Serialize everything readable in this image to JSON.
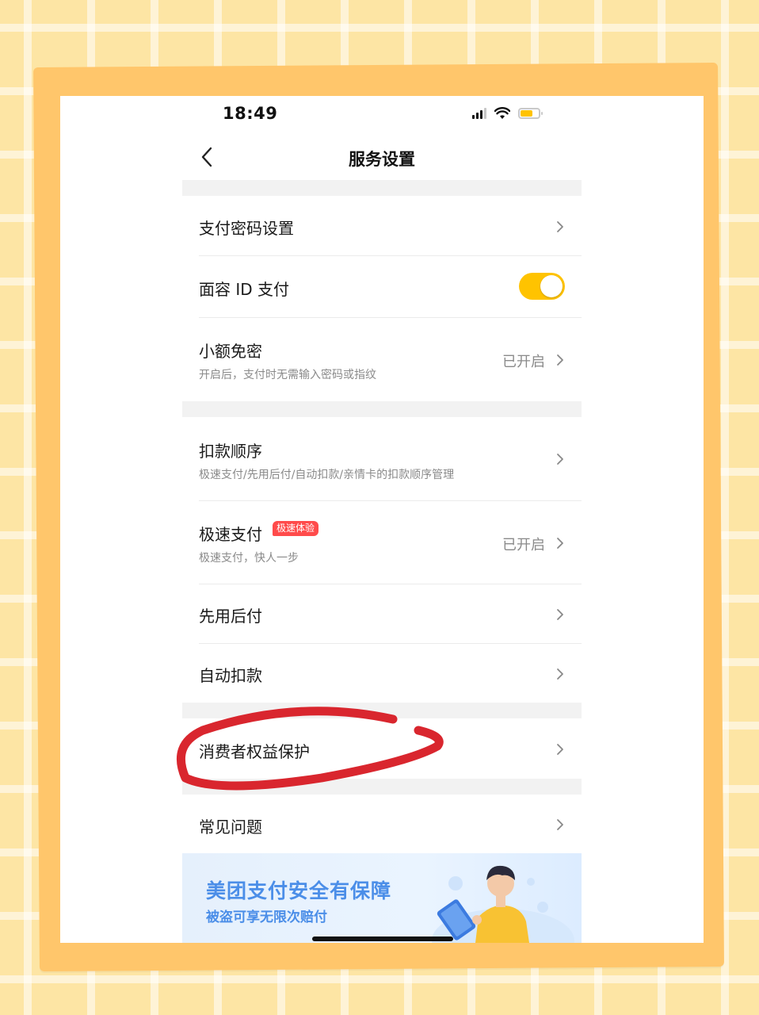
{
  "status_bar": {
    "time": "18:49"
  },
  "nav": {
    "back_icon": "chevron-left-icon",
    "title": "服务设置"
  },
  "settings": {
    "payment_password": {
      "title": "支付密码设置"
    },
    "face_id": {
      "title": "面容 ID 支付",
      "enabled": true
    },
    "small_amount": {
      "title": "小额免密",
      "subtitle": "开启后，支付时无需输入密码或指纹",
      "value": "已开启"
    },
    "deduction_order": {
      "title": "扣款顺序",
      "subtitle": "极速支付/先用后付/自动扣款/亲情卡的扣款顺序管理"
    },
    "fast_pay": {
      "title": "极速支付",
      "badge": "极速体验",
      "subtitle": "极速支付，快人一步",
      "value": "已开启"
    },
    "pay_later": {
      "title": "先用后付"
    },
    "auto_deduct": {
      "title": "自动扣款"
    },
    "consumer_protection": {
      "title": "消费者权益保护"
    },
    "faq": {
      "title": "常见问题"
    }
  },
  "banner": {
    "title": "美团支付安全有保障",
    "subtitle": "被盗可享无限次赔付"
  },
  "colors": {
    "accent": "#ffc300",
    "badge": "#ff4b4b",
    "banner_text": "#4b8ee8",
    "annotation": "#d9262e",
    "frame": "#ffc66b"
  }
}
